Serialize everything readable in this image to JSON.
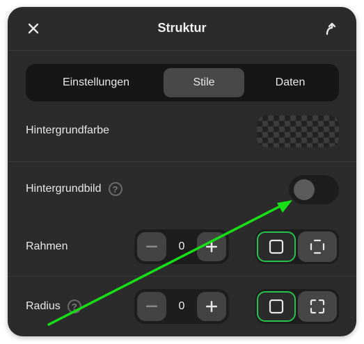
{
  "header": {
    "title": "Struktur",
    "close_icon": "close-icon",
    "share_icon": "share-icon"
  },
  "tabs": [
    {
      "label": "Einstellungen",
      "active": false
    },
    {
      "label": "Stile",
      "active": true
    },
    {
      "label": "Daten",
      "active": false
    }
  ],
  "rows": {
    "background_color": {
      "label": "Hintergrundfarbe",
      "value": "transparent"
    },
    "background_image": {
      "label": "Hintergrundbild",
      "help": "?",
      "enabled": false
    },
    "border": {
      "label": "Rahmen",
      "value": "0",
      "minus": "−",
      "plus": "+"
    },
    "radius": {
      "label": "Radius",
      "help": "?",
      "value": "0",
      "minus": "−",
      "plus": "+"
    }
  },
  "colors": {
    "panel": "#2b2b2b",
    "accent_green": "#27c24c",
    "annotation_arrow": "#18e018"
  }
}
